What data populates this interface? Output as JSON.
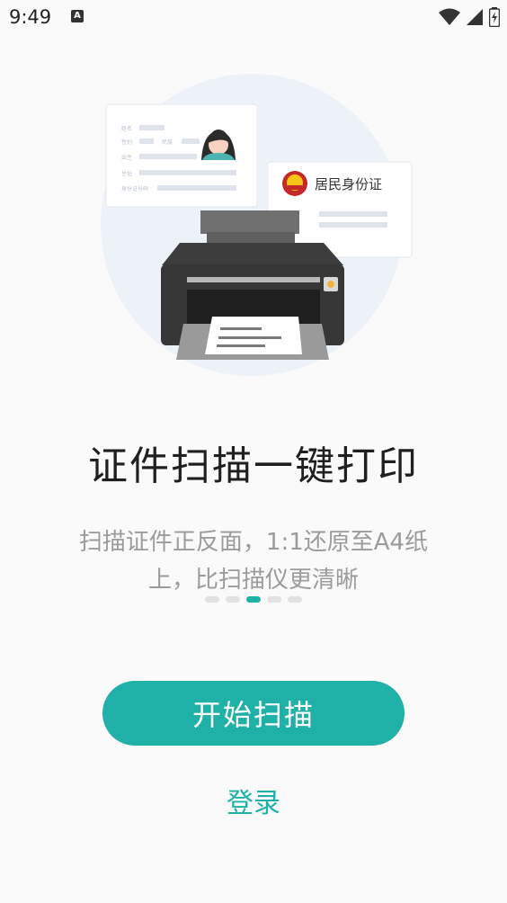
{
  "status_bar": {
    "time": "9:49",
    "notif_icon_letter": "A"
  },
  "illustration": {
    "id_card_title": "居民身份证",
    "form_labels": [
      "姓名",
      "性别",
      "民族",
      "出生",
      "住址",
      "身份证号码"
    ]
  },
  "onboarding": {
    "title": "证件扫描一键打印",
    "subtitle": "扫描证件正反面，1:1还原至A4纸上，比扫描仪更清晰",
    "page_count": 5,
    "active_page": 3
  },
  "actions": {
    "start_label": "开始扫描",
    "login_label": "登录"
  },
  "colors": {
    "accent": "#1fb0a8",
    "title": "#1f1f1f",
    "subtitle": "#9b9b9b"
  }
}
